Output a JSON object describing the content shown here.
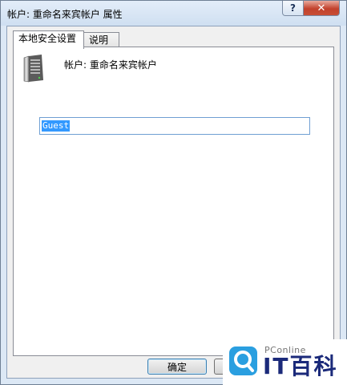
{
  "window": {
    "title": "帐户: 重命名来宾帐户 属性",
    "help_label": "?",
    "close_label": "✕"
  },
  "tabs": [
    {
      "label": "本地安全设置",
      "active": true
    },
    {
      "label": "说明",
      "active": false
    }
  ],
  "panel": {
    "icon": "server-icon",
    "account_label": "帐户: 重命名来宾帐户",
    "input_value": "Guest"
  },
  "buttons": {
    "ok_label": "确定",
    "cancel_label": ""
  },
  "watermark": {
    "small_text": "PConline",
    "big_text": "IT百科",
    "icon": "pconline-logo-icon"
  },
  "colors": {
    "selection": "#3399ff",
    "close_button": "#c74f36",
    "watermark_text": "#1b2a7a"
  }
}
